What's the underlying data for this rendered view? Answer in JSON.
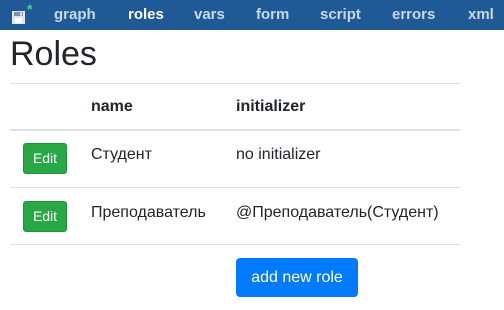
{
  "nav": {
    "modified_marker": "*",
    "items": [
      {
        "label": "graph"
      },
      {
        "label": "roles"
      },
      {
        "label": "vars"
      },
      {
        "label": "form"
      },
      {
        "label": "script"
      },
      {
        "label": "errors"
      },
      {
        "label": "xml"
      }
    ],
    "active": "roles"
  },
  "page": {
    "title": "Roles"
  },
  "table": {
    "headers": {
      "name": "name",
      "initializer": "initializer"
    },
    "rows": [
      {
        "edit_label": "Edit",
        "name": "Студент",
        "initializer": "no initializer"
      },
      {
        "edit_label": "Edit",
        "name": "Преподаватель",
        "initializer": "@Преподаватель(Студент)"
      }
    ]
  },
  "actions": {
    "add_role_label": "add new role"
  },
  "colors": {
    "navbar": "#1f5a96",
    "edit_button": "#28a745",
    "primary_button": "#007bff"
  }
}
